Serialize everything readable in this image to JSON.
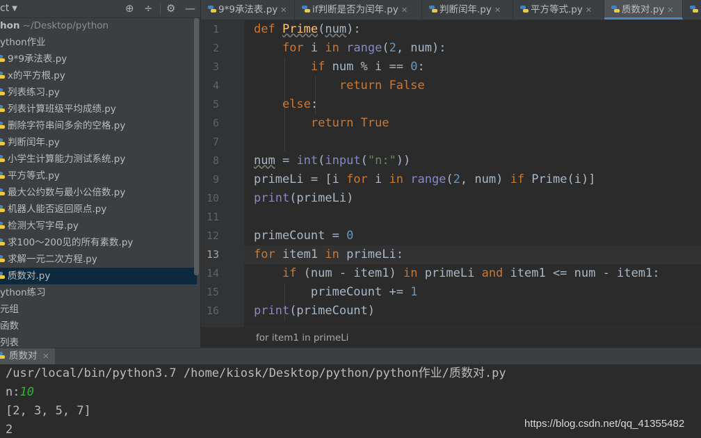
{
  "project": {
    "title": "ct",
    "root": "hon",
    "root_path": "~/Desktop/python",
    "folder": "ython作业",
    "files": [
      "9*9承法表.py",
      "x的平方根.py",
      "列表练习.py",
      "列表计算班级平均成绩.py",
      "删除字符串间多余的空格.py",
      "判断闰年.py",
      "小学生计算能力测试系统.py",
      "平方等式.py",
      "最大公约数与最小公倍数.py",
      "机器人能否返回原点.py",
      "检测大写字母.py",
      "求100～200见的所有素数.py",
      "求解一元二次方程.py",
      "质数对.py"
    ],
    "after": [
      "ython练习",
      "元组",
      "函数",
      "列表"
    ]
  },
  "tabs": [
    {
      "label": "9*9承法表.py"
    },
    {
      "label": "if判断是否为闰年.py"
    },
    {
      "label": "判断闰年.py"
    },
    {
      "label": "平方等式.py"
    },
    {
      "label": "质数对.py",
      "active": true
    }
  ],
  "editor": {
    "line_numbers": [
      "1",
      "2",
      "3",
      "4",
      "5",
      "6",
      "7",
      "8",
      "9",
      "10",
      "11",
      "12",
      "13",
      "14",
      "15",
      "16"
    ],
    "current_line": "13",
    "breadcrumb": "for item1 in primeLi"
  },
  "run": {
    "tab_label": "质数对",
    "output": [
      "/usr/local/bin/python3.7 /home/kiosk/Desktop/python/python作业/质数对.py",
      "n:",
      "[2, 3, 5, 7]",
      "2"
    ],
    "user_input": "10"
  },
  "watermark": "https://blog.csdn.net/qq_41355482",
  "colors": {
    "keyword": "#cc7832",
    "function": "#ffc66d",
    "builtin": "#8888c6",
    "number": "#6897bb",
    "string": "#6a8759",
    "text": "#a9b7c6",
    "input": "#2fb52f",
    "background": "#2b2b2b",
    "panel": "#3c3f41",
    "selection": "#0d293e"
  },
  "icons": [
    "add-target-icon",
    "collapse-icon",
    "gear-icon",
    "minimize-icon",
    "python-file-icon",
    "close-icon"
  ]
}
